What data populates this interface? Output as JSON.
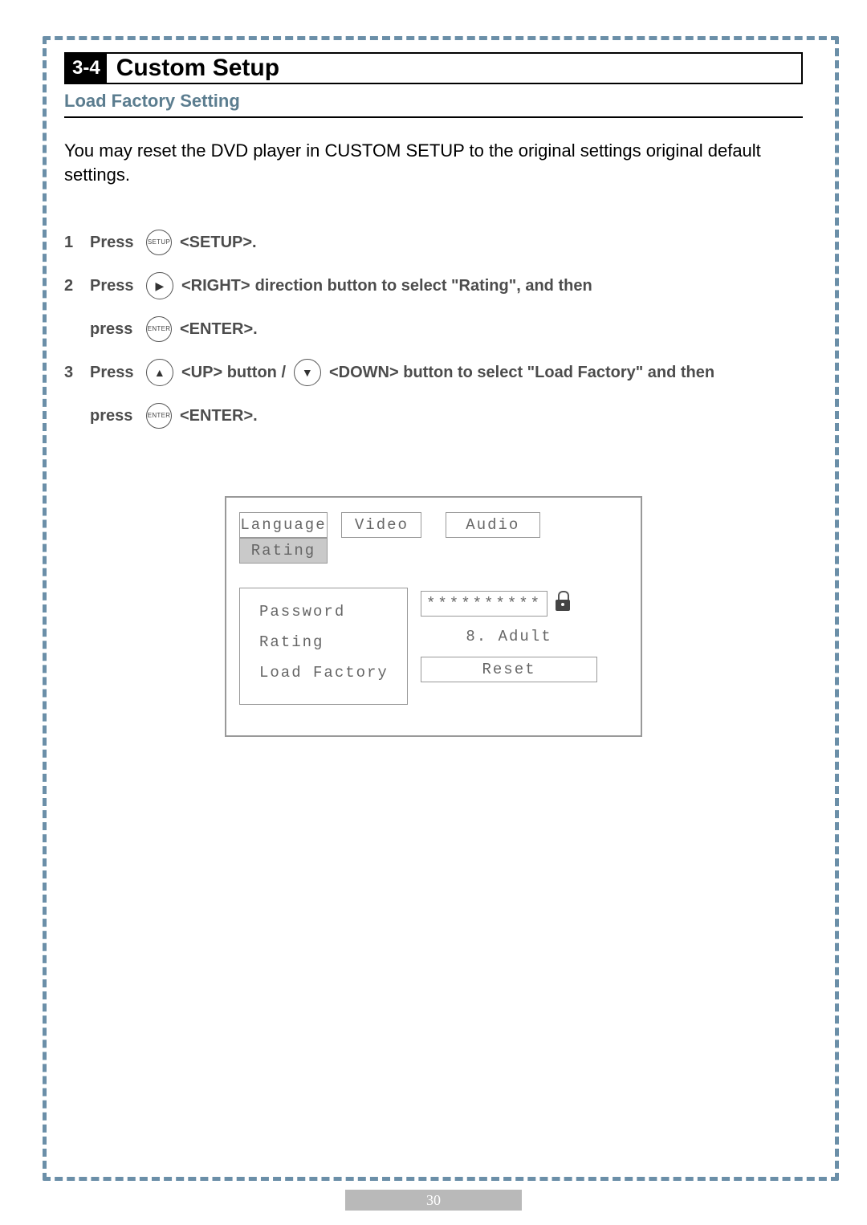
{
  "section_number": "3-4",
  "section_title": "Custom Setup",
  "subtitle": "Load Factory Setting",
  "intro": "You may reset the DVD player in CUSTOM SETUP to the original settings original default settings.",
  "steps": {
    "s1": {
      "num": "1",
      "press": "Press",
      "btn": "SETUP",
      "tag": "<SETUP>.",
      "rest": ""
    },
    "s2a": {
      "num": "2",
      "press": "Press",
      "btn_arrow": "▶",
      "tag": "<RIGHT>",
      "rest": " direction button to select \"Rating\", and then"
    },
    "s2b": {
      "press": "press",
      "btn": "ENTER",
      "tag": "<ENTER>."
    },
    "s3a": {
      "num": "3",
      "press": "Press",
      "btn_up": "▲",
      "tag_up": "<UP> button / ",
      "btn_down": "▼",
      "tag_down": "<DOWN> button to select  \"Load Factory\" and then"
    },
    "s3b": {
      "press": "press",
      "btn": "ENTER",
      "tag": "<ENTER>."
    }
  },
  "osd": {
    "tabs": {
      "lang": "Language",
      "video": "Video",
      "audio": "Audio",
      "rating": "Rating"
    },
    "left": {
      "password": "Password",
      "rating": "Rating",
      "load": "Load Factory"
    },
    "right": {
      "pw_value": "**********",
      "rating_value": "8. Adult",
      "load_value": "Reset"
    }
  },
  "page_number": "30"
}
